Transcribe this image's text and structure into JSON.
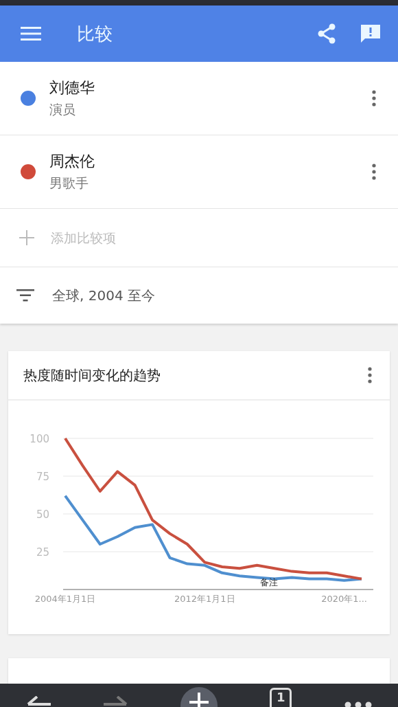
{
  "app_bar": {
    "title": "比较"
  },
  "terms": [
    {
      "name": "刘德华",
      "subtitle": "演员",
      "color": "#4a80e0"
    },
    {
      "name": "周杰伦",
      "subtitle": "男歌手",
      "color": "#d04a3a"
    }
  ],
  "add_term": {
    "placeholder": "添加比较项"
  },
  "filter": {
    "label": "全球, 2004 至今"
  },
  "trend_card": {
    "title": "热度随时间变化的趋势",
    "chart_data": {
      "type": "line",
      "categories": [
        "2004年1月1日",
        null,
        null,
        null,
        null,
        null,
        null,
        null,
        "2012年1月1日",
        null,
        null,
        null,
        null,
        null,
        null,
        null,
        "2020年1...",
        null
      ],
      "series": [
        {
          "color": "#4f8fcf",
          "values": [
            62,
            46,
            30,
            35,
            41,
            43,
            21,
            17,
            16,
            11,
            9,
            8,
            7,
            8,
            7,
            7,
            6,
            7
          ]
        },
        {
          "color": "#c9503f",
          "values": [
            100,
            82,
            65,
            78,
            69,
            46,
            37,
            30,
            18,
            15,
            14,
            16,
            14,
            12,
            11,
            11,
            9,
            7
          ]
        }
      ],
      "ylim": [
        0,
        100
      ],
      "yticks": [
        25,
        50,
        75,
        100
      ],
      "grid": true,
      "annotations": [
        {
          "text": "备注"
        }
      ]
    }
  },
  "browser_bar": {
    "tab_count": "1",
    "forward_disabled": true
  }
}
